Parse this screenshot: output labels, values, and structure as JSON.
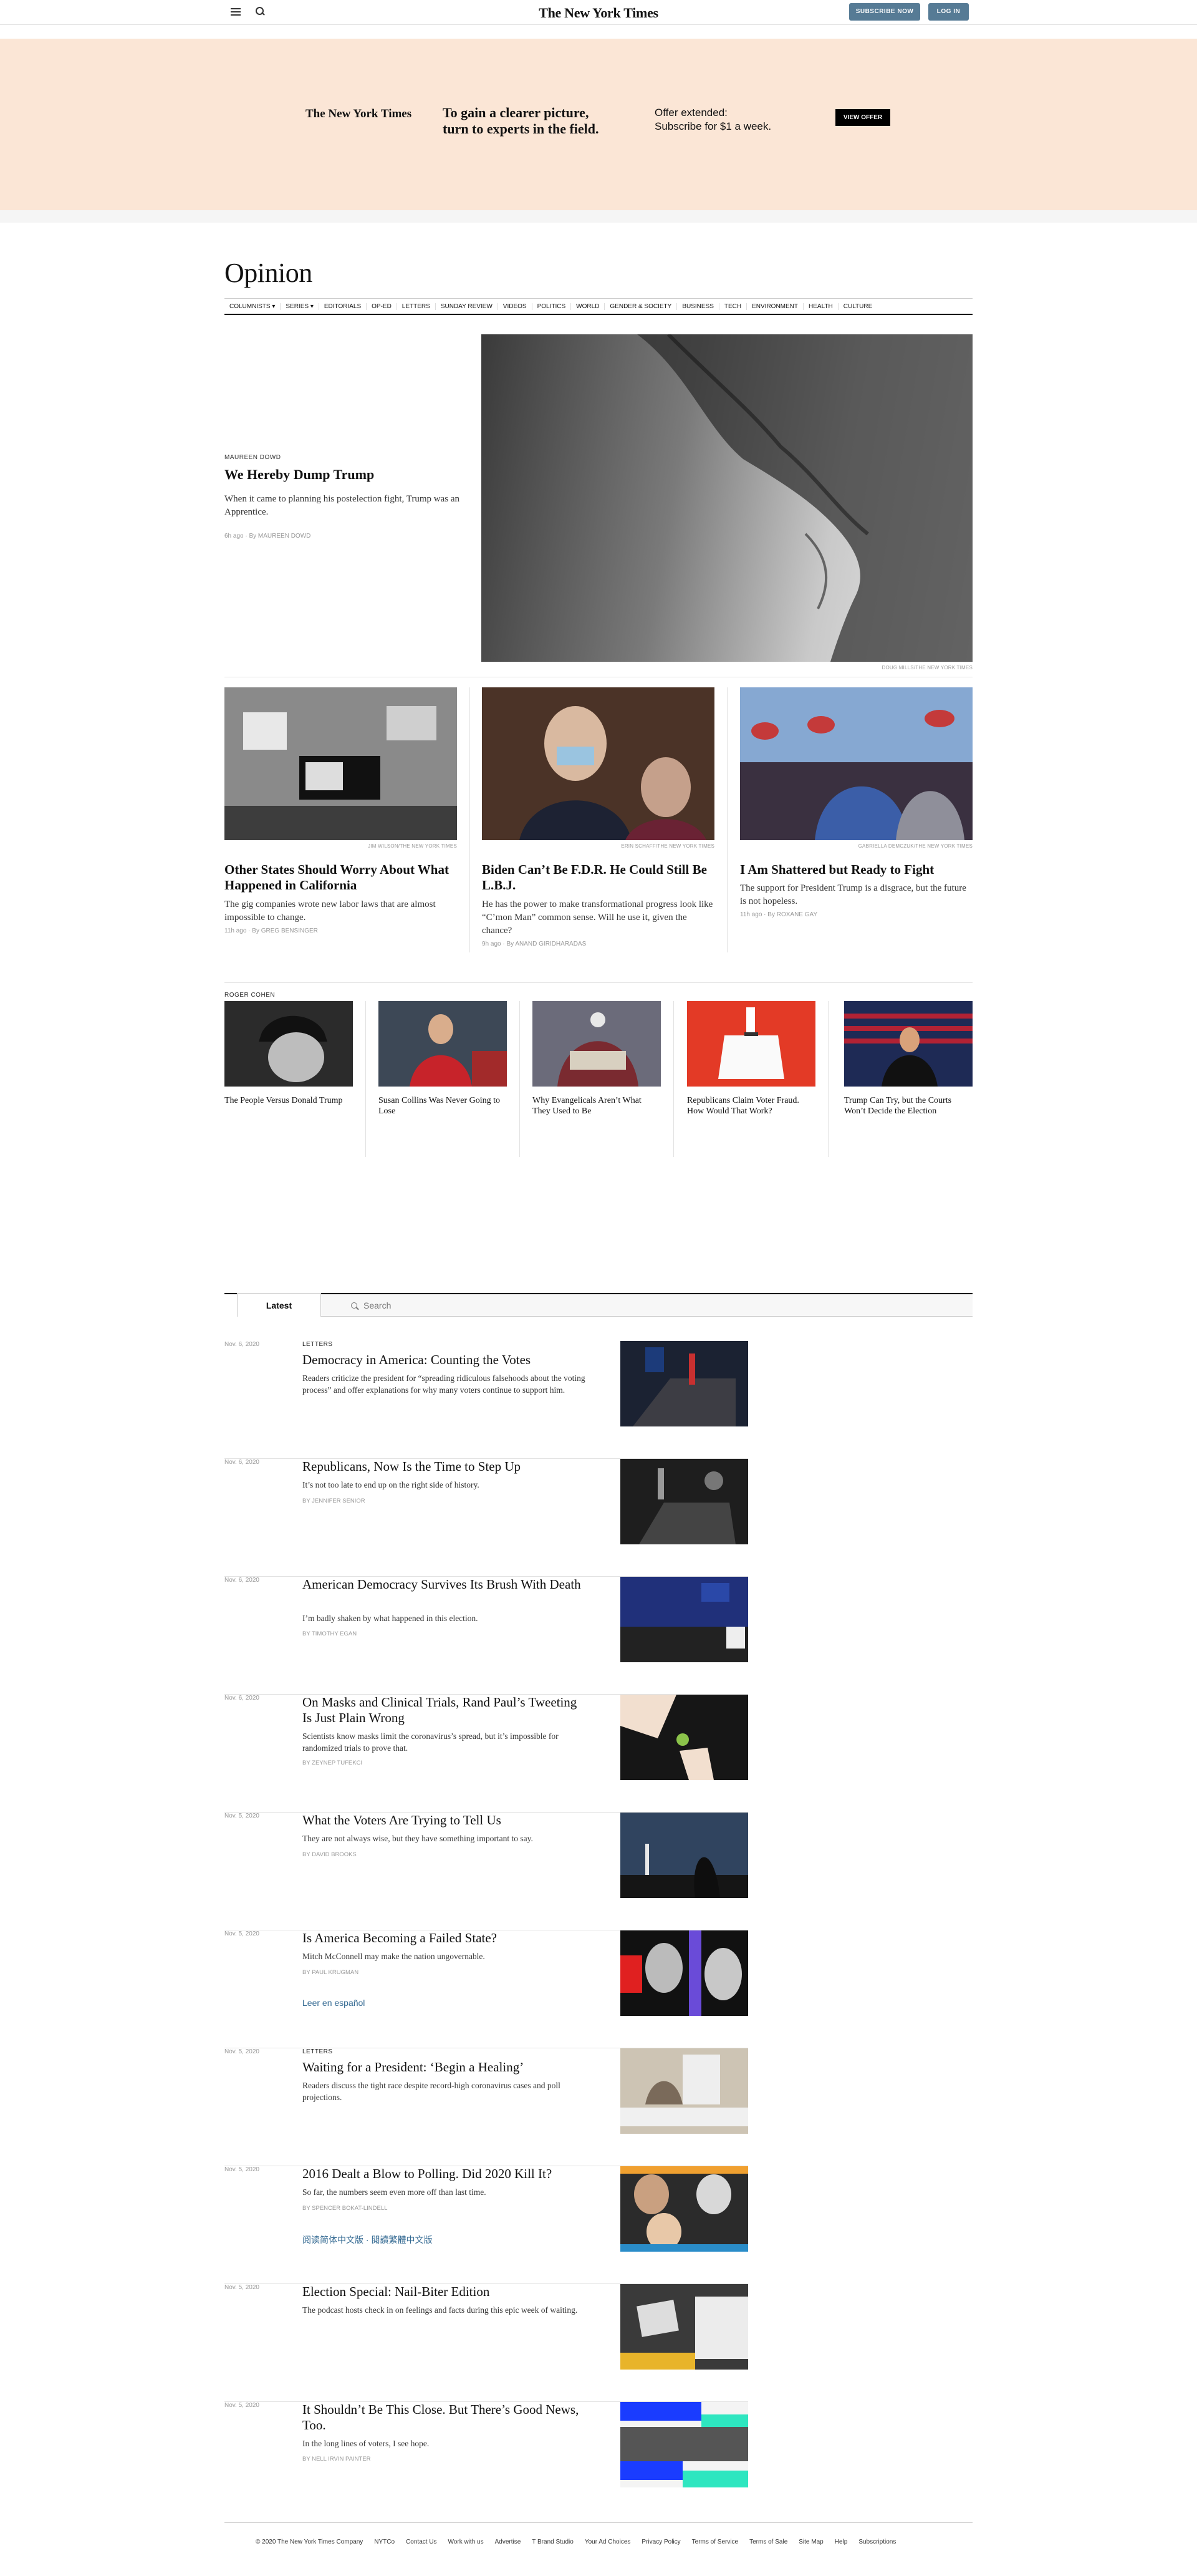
{
  "header": {
    "logo": "The New York Times",
    "subscribe_label": "SUBSCRIBE NOW",
    "login_label": "LOG IN"
  },
  "promo": {
    "logo": "The New York Times",
    "headline_line1": "To gain a clearer picture,",
    "headline_line2": "turn to experts in the field.",
    "offer_line1": "Offer extended:",
    "offer_line2": "Subscribe for $1 a week.",
    "button": "VIEW OFFER"
  },
  "section": {
    "title": "Opinion",
    "nav": [
      "COLUMNISTS ▾",
      "SERIES ▾",
      "EDITORIALS",
      "OP-ED",
      "LETTERS",
      "SUNDAY REVIEW",
      "VIDEOS",
      "POLITICS",
      "WORLD",
      "GENDER & SOCIETY",
      "BUSINESS",
      "TECH",
      "ENVIRONMENT",
      "HEALTH",
      "CULTURE"
    ]
  },
  "lead": {
    "kicker": "MAUREEN DOWD",
    "headline": "We Hereby Dump Trump",
    "summary": "When it came to planning his postelection fight, Trump was an Apprentice.",
    "meta": "6h ago  ·  By MAUREEN DOWD",
    "credit": "DOUG MILLS/THE NEW YORK TIMES"
  },
  "trio": [
    {
      "headline": "Other States Should Worry About What Happened in California",
      "summary": "The gig companies wrote new labor laws that are almost impossible to change.",
      "meta": "11h ago  ·  By GREG BENSINGER",
      "credit": "JIM WILSON/THE NEW YORK TIMES"
    },
    {
      "headline": "Biden Can’t Be F.D.R. He Could Still Be L.B.J.",
      "summary": "He has the power to make transformational progress look like “C’mon Man” common sense. Will he use it, given the chance?",
      "meta": "9h ago  ·  By ANAND GIRIDHARADAS",
      "credit": "ERIN SCHAFF/THE NEW YORK TIMES"
    },
    {
      "headline": "I Am Shattered but Ready to Fight",
      "summary": "The support for President Trump is a disgrace, but the future is not hopeless.",
      "meta": "11h ago  ·  By ROXANE GAY",
      "credit": "GABRIELLA DEMCZUK/THE NEW YORK TIMES"
    }
  ],
  "cohen": {
    "kicker": "ROGER COHEN",
    "items": [
      {
        "headline": "The People Versus Donald Trump"
      },
      {
        "headline": "Susan Collins Was Never Going to Lose"
      },
      {
        "headline": "Why Evangelicals Aren’t What They Used to Be"
      },
      {
        "headline": "Republicans Claim Voter Fraud. How Would That Work?"
      },
      {
        "headline": "Trump Can Try, but the Courts Won’t Decide the Election"
      }
    ]
  },
  "latest": {
    "tab": "Latest",
    "search_placeholder": "Search",
    "stories": [
      {
        "date": "Nov. 6, 2020",
        "label": "LETTERS",
        "headline": "Democracy in America: Counting the Votes",
        "summary": "Readers criticize the president for “spreading ridiculous falsehoods about the voting process” and offer explanations for why many voters continue to support him.",
        "byline": "",
        "lang": ""
      },
      {
        "date": "Nov. 6, 2020",
        "label": "",
        "headline": "Republicans, Now Is the Time to Step Up",
        "summary": "It’s not too late to end up on the right side of history.",
        "byline": "By JENNIFER SENIOR",
        "lang": ""
      },
      {
        "date": "Nov. 6, 2020",
        "label": "",
        "headline": "American Democracy Survives Its Brush With Death",
        "summary": "I’m badly shaken by what happened in this election.",
        "byline": "By TIMOTHY EGAN",
        "lang": ""
      },
      {
        "date": "Nov. 6, 2020",
        "label": "",
        "headline": "On Masks and Clinical Trials, Rand Paul’s Tweeting Is Just Plain Wrong",
        "summary": "Scientists know masks limit the coronavirus’s spread, but it’s impossible for randomized trials to prove that.",
        "byline": "By ZEYNEP TUFEKCI",
        "lang": ""
      },
      {
        "date": "Nov. 5, 2020",
        "label": "",
        "headline": "What the Voters Are Trying to Tell Us",
        "summary": "They are not always wise, but they have something important to say.",
        "byline": "By DAVID BROOKS",
        "lang": ""
      },
      {
        "date": "Nov. 5, 2020",
        "label": "",
        "headline": "Is America Becoming a Failed State?",
        "summary": "Mitch McConnell may make the nation ungovernable.",
        "byline": "By PAUL KRUGMAN",
        "lang": "Leer en español"
      },
      {
        "date": "Nov. 5, 2020",
        "label": "LETTERS",
        "headline": "Waiting for a President: ‘Begin a Healing’",
        "summary": "Readers discuss the tight race despite record-high coronavirus cases and poll projections.",
        "byline": "",
        "lang": ""
      },
      {
        "date": "Nov. 5, 2020",
        "label": "",
        "headline": "2016 Dealt a Blow to Polling. Did 2020 Kill It?",
        "summary": "So far, the numbers seem even more off than last time.",
        "byline": "By SPENCER BOKAT-LINDELL",
        "lang": "阅读简体中文版 · 閱讀繁體中文版"
      },
      {
        "date": "Nov. 5, 2020",
        "label": "",
        "headline": "Election Special: Nail-Biter Edition",
        "summary": "The podcast hosts check in on feelings and facts during this epic week of waiting.",
        "byline": "",
        "lang": ""
      },
      {
        "date": "Nov. 5, 2020",
        "label": "",
        "headline": "It Shouldn’t Be This Close. But There’s Good News, Too.",
        "summary": "In the long lines of voters, I see hope.",
        "byline": "By NELL IRVIN PAINTER",
        "lang": ""
      }
    ]
  },
  "footer": {
    "links": [
      "© 2020 The New York Times Company",
      "NYTCo",
      "Contact Us",
      "Work with us",
      "Advertise",
      "T Brand Studio",
      "Your Ad Choices",
      "Privacy Policy",
      "Terms of Service",
      "Terms of Sale",
      "Site Map",
      "Help",
      "Subscriptions"
    ]
  }
}
